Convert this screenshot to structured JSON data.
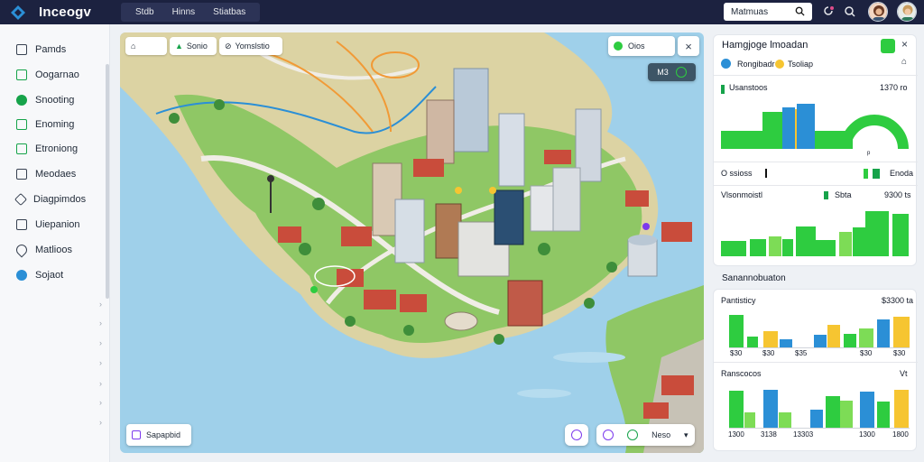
{
  "app": {
    "name": "Inceogv"
  },
  "nav": [
    "Stdb",
    "Hinns",
    "Stiatbas"
  ],
  "search": {
    "text": "Matmuas"
  },
  "sidebar": {
    "items": [
      {
        "label": "Pamds",
        "icon": "square-icon"
      },
      {
        "label": "Oogarnao",
        "icon": "grid-icon"
      },
      {
        "label": "Snooting",
        "icon": "leaf-icon"
      },
      {
        "label": "Enoming",
        "icon": "square-icon"
      },
      {
        "label": "Etroniong",
        "icon": "checkbox-icon"
      },
      {
        "label": "Meodaes",
        "icon": "document-icon"
      },
      {
        "label": "Diagpimdos",
        "icon": "diamond-icon"
      },
      {
        "label": "Uiepanion",
        "icon": "square-icon"
      },
      {
        "label": "Matlioos",
        "icon": "location-pin-icon"
      },
      {
        "label": "Sojaot",
        "icon": "globe-icon"
      }
    ]
  },
  "map": {
    "chips": [
      "",
      "Sonio",
      "Yomslstio"
    ],
    "top_right_chip": "Oios",
    "dark_button": "M3",
    "bottom_left_label": "Sapapbid",
    "bottom_button": "Neso"
  },
  "panel1": {
    "title": "Hamgjoge lmoadan",
    "tag1": "Rongibadr",
    "tag2": "Tsoliap",
    "metric_label": "Usanstoos",
    "metric_value": "1370 ro",
    "small_label": "p",
    "row2_left": "O ssioss",
    "row2_right": "Enoda",
    "section2_label": "Vlsonmoistl",
    "section2_mid": "Sbta",
    "section2_value": "9300 ts"
  },
  "panel2": {
    "header": "Sanannobuaton",
    "section1_label": "Pantisticy",
    "section1_value": "$3300 ta",
    "section1_xlabels": [
      "$30",
      "$30",
      "$35",
      "$30",
      "$30"
    ],
    "section2_label": "Ranscocos",
    "section2_value": "Vt",
    "section2_xlabels": [
      "1300",
      "3138",
      "13303",
      "1300",
      "1800"
    ]
  },
  "colors": {
    "green": "#2ecc40",
    "blue": "#2b8fd6",
    "yellow": "#f6c531",
    "light_green": "#7ddc56",
    "navy": "#1c2240"
  }
}
